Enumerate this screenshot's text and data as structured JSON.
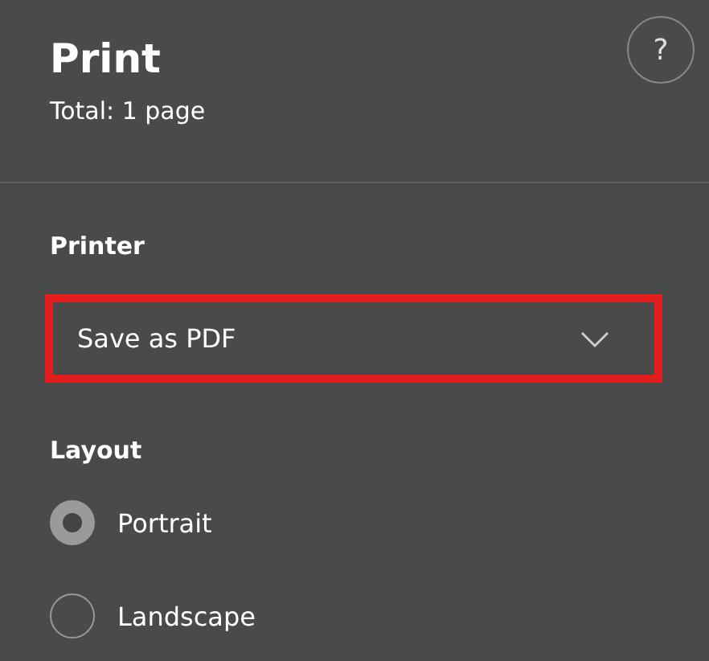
{
  "header": {
    "title": "Print",
    "subtitle": "Total: 1 page",
    "help": "?"
  },
  "printer": {
    "label": "Printer",
    "value": "Save as PDF",
    "highlighted": true
  },
  "layout": {
    "label": "Layout",
    "options": [
      {
        "label": "Portrait",
        "selected": true
      },
      {
        "label": "Landscape",
        "selected": false
      }
    ]
  }
}
